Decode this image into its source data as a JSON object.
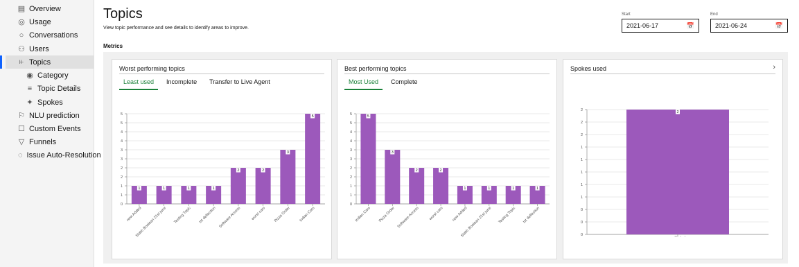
{
  "sidebar": {
    "items": [
      {
        "label": "Overview",
        "icon": "calendar-icon",
        "level": 1
      },
      {
        "label": "Usage",
        "icon": "gauge-icon",
        "level": 1
      },
      {
        "label": "Conversations",
        "icon": "chat-bubble-icon",
        "level": 1
      },
      {
        "label": "Users",
        "icon": "users-icon",
        "level": 1
      },
      {
        "label": "Topics",
        "icon": "topics-icon",
        "level": 1,
        "active": true
      },
      {
        "label": "Category",
        "icon": "eye-icon",
        "level": 2
      },
      {
        "label": "Topic Details",
        "icon": "list-icon",
        "level": 2
      },
      {
        "label": "Spokes",
        "icon": "spokes-icon",
        "level": 2
      },
      {
        "label": "NLU prediction",
        "icon": "bulb-icon",
        "level": 1
      },
      {
        "label": "Custom Events",
        "icon": "cursor-icon",
        "level": 1
      },
      {
        "label": "Funnels",
        "icon": "funnel-icon",
        "level": 1
      },
      {
        "label": "Issue Auto-Resolution",
        "icon": "resolve-icon",
        "level": 1
      }
    ]
  },
  "header": {
    "title": "Topics",
    "subtitle": "View topic performance and see details to identify areas to improve."
  },
  "dates": {
    "start_label": "Start",
    "start_value": "2021-06-17",
    "end_label": "End",
    "end_value": "2021-06-24"
  },
  "metrics_label": "Metrics",
  "colors": {
    "bar": "#9c59bb",
    "active_tab": "#198038",
    "accent": "#0f62fe"
  },
  "cards": {
    "worst": {
      "title": "Worst performing topics",
      "tabs": [
        "Least used",
        "Incomplete",
        "Transfer to Live Agent"
      ],
      "active_tab": 0
    },
    "best": {
      "title": "Best performing topics",
      "tabs": [
        "Most Used",
        "Complete"
      ],
      "active_tab": 0
    },
    "spokes": {
      "title": "Spokes used",
      "chevron": "chevron-right-icon"
    }
  },
  "chart_data": [
    {
      "type": "bar",
      "title": "Worst performing topics",
      "categories": [
        "new Added",
        "Static Boolean 21st june",
        "Testing Topic",
        "tst deflection",
        "Software Access",
        "worst cars",
        "Pizza Order",
        "Indian Cars"
      ],
      "values": [
        1,
        1,
        1,
        1,
        2,
        2,
        3,
        5
      ],
      "y_tick_labels": [
        "0",
        "1",
        "1",
        "2",
        "2",
        "3",
        "3",
        "4",
        "4",
        "5",
        "5"
      ],
      "ylim": [
        0,
        5
      ],
      "grid": true
    },
    {
      "type": "bar",
      "title": "Best performing topics",
      "categories": [
        "Indian Cars",
        "Pizza Order",
        "Software Access",
        "worst cars",
        "new Added",
        "Static Boolean 21st june",
        "Testing Topic",
        "tst deflection"
      ],
      "values": [
        5,
        3,
        2,
        2,
        1,
        1,
        1,
        1
      ],
      "y_tick_labels": [
        "0",
        "1",
        "1",
        "2",
        "2",
        "3",
        "3",
        "4",
        "4",
        "5",
        "5"
      ],
      "ylim": [
        0,
        5
      ],
      "grid": true
    },
    {
      "type": "bar",
      "title": "Spokes used",
      "categories": [
        "Global"
      ],
      "values": [
        2
      ],
      "y_tick_labels": [
        "0",
        "0",
        "0",
        "1",
        "1",
        "1",
        "1",
        "1",
        "2",
        "2",
        "2"
      ],
      "ylim": [
        0,
        2
      ],
      "grid": true
    }
  ]
}
